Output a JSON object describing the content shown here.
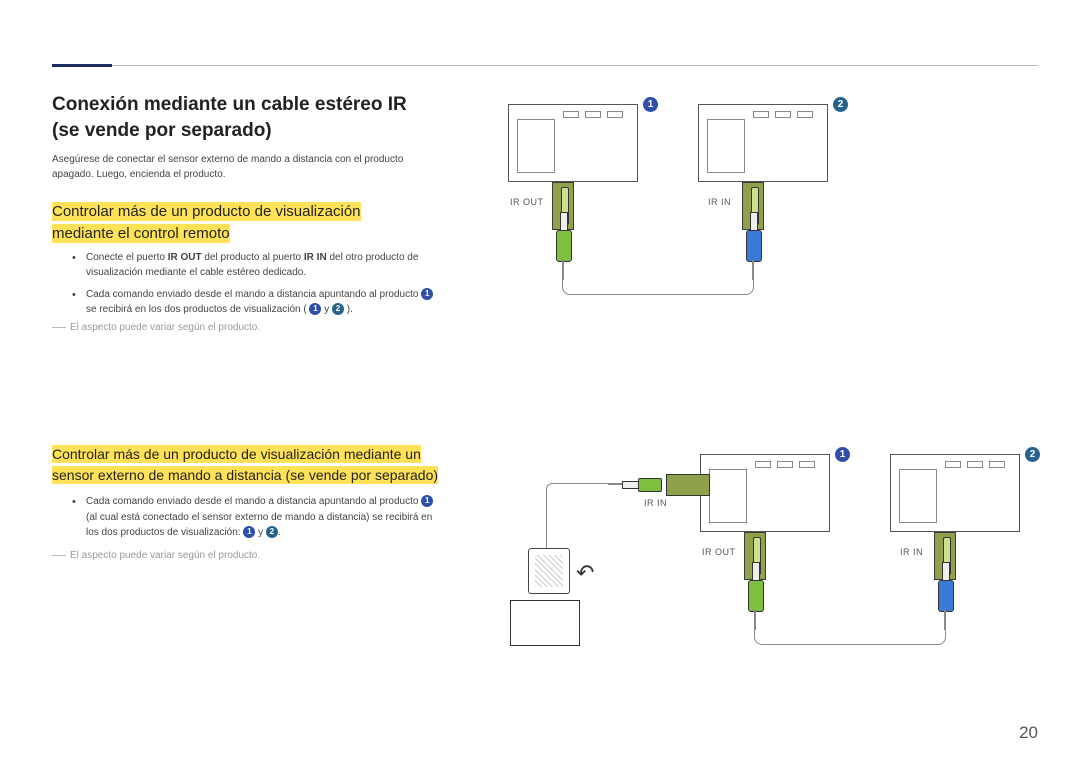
{
  "page_number": "20",
  "title": "Conexión mediante un cable estéreo IR (se vende por separado)",
  "intro": "Asegúrese de conectar el sensor externo de mando a distancia con el producto apagado. Luego, encienda el producto.",
  "section1": {
    "heading_l1": "Controlar más de un producto de visualización",
    "heading_l2": "mediante el control remoto",
    "bullet1_pre": "Conecte el puerto ",
    "bullet1_irout": "IR OUT",
    "bullet1_mid": " del producto al puerto ",
    "bullet1_irin": "IR IN",
    "bullet1_post": " del otro producto de visualización mediante el cable estéreo dedicado.",
    "bullet2_pre": "Cada comando enviado desde el mando a distancia apuntando al producto ",
    "bullet2_mid": " se recibirá en los dos productos de visualización ( ",
    "bullet2_y": " y ",
    "bullet2_end": " ).",
    "note": "El aspecto puede variar según el producto."
  },
  "section2": {
    "heading_l1": "Controlar más de un producto de visualización mediante un",
    "heading_l2": "sensor externo de mando a distancia (se vende por separado)",
    "bullet1_pre": "Cada comando enviado desde el mando a distancia apuntando al producto ",
    "bullet1_mid": " (al cual está conectado el sensor externo de mando a distancia) se recibirá en los dos productos de visualización: ",
    "bullet1_y": " y ",
    "bullet1_end": ".",
    "note": "El aspecto puede variar según el producto."
  },
  "labels": {
    "ir_out": "IR OUT",
    "ir_in": "IR IN",
    "b1": "1",
    "b2": "2"
  }
}
